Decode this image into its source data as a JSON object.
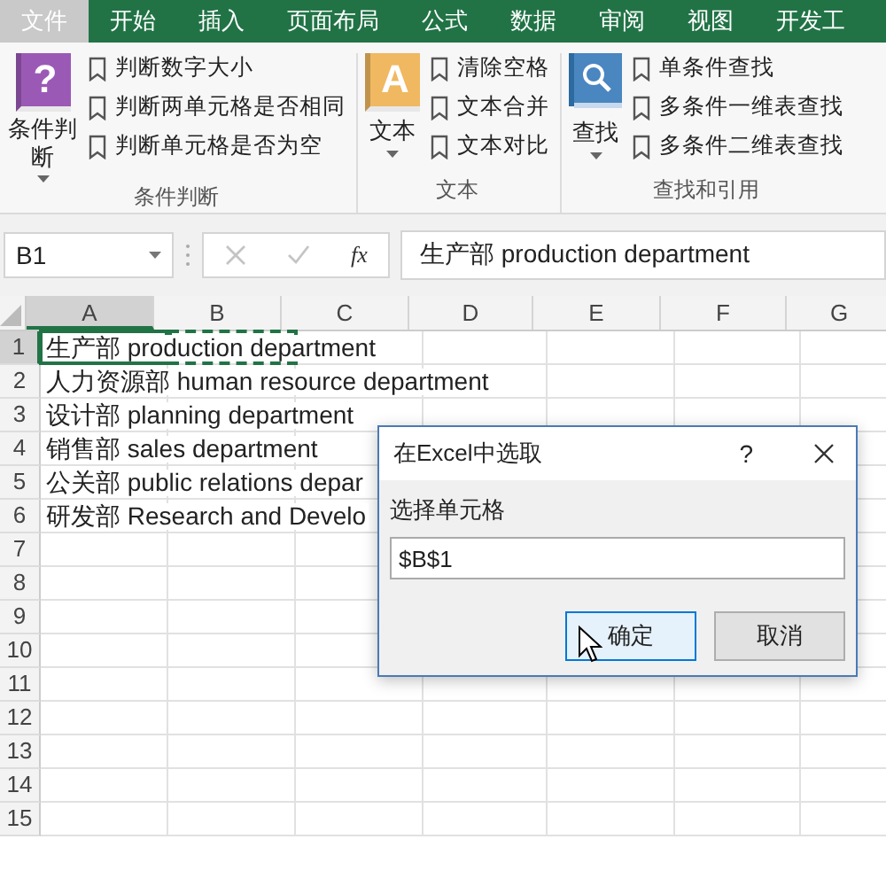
{
  "tabs": [
    {
      "label": "文件",
      "selected": true
    },
    {
      "label": "开始",
      "selected": false
    },
    {
      "label": "插入",
      "selected": false
    },
    {
      "label": "页面布局",
      "selected": false
    },
    {
      "label": "公式",
      "selected": false
    },
    {
      "label": "数据",
      "selected": false
    },
    {
      "label": "审阅",
      "selected": false
    },
    {
      "label": "视图",
      "selected": false
    },
    {
      "label": "开发工",
      "selected": false
    }
  ],
  "ribbon_groups": [
    {
      "label": "条件判断",
      "big_button": {
        "label": "条件判断",
        "kind": "question",
        "glyph": "?"
      },
      "items": [
        "判断数字大小",
        "判断两单元格是否相同",
        "判断单元格是否为空"
      ]
    },
    {
      "label": "文本",
      "big_button": {
        "label": "文本",
        "kind": "letter",
        "glyph": "A"
      },
      "items": [
        "清除空格",
        "文本合并",
        "文本对比"
      ]
    },
    {
      "label": "查找和引用",
      "big_button": {
        "label": "查找",
        "kind": "search"
      },
      "items": [
        "单条件查找",
        "多条件一维表查找",
        "多条件二维表查找"
      ]
    }
  ],
  "formula_bar": {
    "name_box": "B1",
    "fx": "fx",
    "formula": "生产部 production department"
  },
  "columns": [
    "A",
    "B",
    "C",
    "D",
    "E",
    "F",
    "G"
  ],
  "rows": [
    {
      "header": "1",
      "selected": true,
      "text": "生产部 production department"
    },
    {
      "header": "2",
      "selected": false,
      "text": "人力资源部 human resource department"
    },
    {
      "header": "3",
      "selected": false,
      "text": "设计部 planning department"
    },
    {
      "header": "4",
      "selected": false,
      "text": "销售部 sales department"
    },
    {
      "header": "5",
      "selected": false,
      "text": "公关部 public relations depar"
    },
    {
      "header": "6",
      "selected": false,
      "text": "研发部 Research and Develo"
    },
    {
      "header": "7",
      "selected": false
    },
    {
      "header": "8",
      "selected": false
    },
    {
      "header": "9",
      "selected": false
    },
    {
      "header": "10",
      "selected": false
    },
    {
      "header": "11",
      "selected": false
    },
    {
      "header": "12",
      "selected": false
    },
    {
      "header": "13",
      "selected": false
    },
    {
      "header": "14",
      "selected": false
    },
    {
      "header": "15",
      "selected": false
    }
  ],
  "dialog": {
    "title": "在Excel中选取",
    "help": "?",
    "label": "选择单元格",
    "value": "$B$1",
    "buttons": [
      {
        "label": "确定",
        "highlighted": true
      },
      {
        "label": "取消",
        "highlighted": false
      }
    ]
  }
}
